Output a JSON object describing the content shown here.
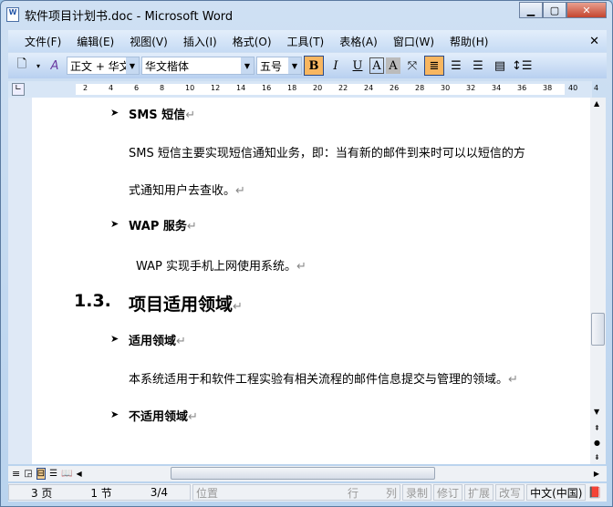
{
  "window": {
    "title": "软件项目计划书.doc - Microsoft Word"
  },
  "menu": [
    "文件(F)",
    "编辑(E)",
    "视图(V)",
    "插入(I)",
    "格式(O)",
    "工具(T)",
    "表格(A)",
    "窗口(W)",
    "帮助(H)"
  ],
  "toolbar": {
    "style": "正文 + 华文",
    "font": "华文楷体",
    "size": "五号",
    "bold": "B",
    "italic": "I",
    "underline": "U",
    "char_border": "A",
    "char_shade": "A"
  },
  "ruler": [
    "2",
    "4",
    "6",
    "8",
    "10",
    "12",
    "14",
    "16",
    "18",
    "20",
    "22",
    "24",
    "26",
    "28",
    "30",
    "32",
    "34",
    "36",
    "38",
    "40",
    "4"
  ],
  "doc": {
    "b1": "SMS 短信",
    "p1a": "SMS 短信主要实现短信通知业务，即：当有新的邮件到来时可以以短信的方",
    "p1b": "式通知用户去查收。",
    "b2": "WAP 服务",
    "p2": "WAP 实现手机上网使用系统。",
    "h_num": "1.3.",
    "h_text": "项目适用领域",
    "b3": "适用领域",
    "p3": "本系统适用于和软件工程实验有相关流程的邮件信息提交与管理的领域。",
    "b4": "不适用领域",
    "mark": "↵"
  },
  "status": {
    "page": "3 页",
    "section": "1 节",
    "pages": "3/4",
    "at": "位置",
    "ln": "行",
    "col": "列",
    "rec": "录制",
    "trk": "修订",
    "ext": "扩展",
    "ovr": "改写",
    "lang": "中文(中国)"
  }
}
